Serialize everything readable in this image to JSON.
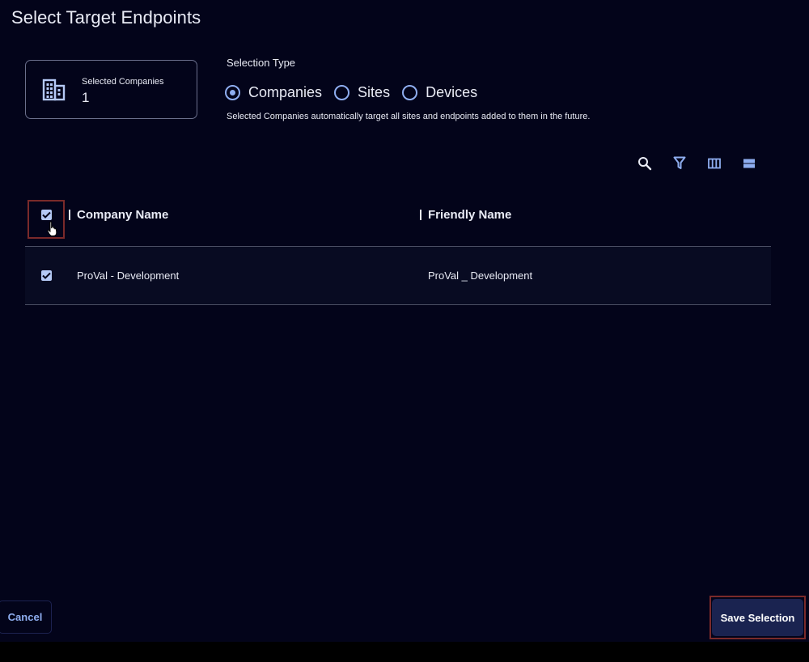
{
  "dialog": {
    "title": "Select Target Endpoints"
  },
  "summary": {
    "label": "Selected Companies",
    "count": "1",
    "icon": "building-icon"
  },
  "selection_type": {
    "label": "Selection Type",
    "options": [
      {
        "label": "Companies",
        "selected": true
      },
      {
        "label": "Sites",
        "selected": false
      },
      {
        "label": "Devices",
        "selected": false
      }
    ],
    "helper_text": "Selected Companies automatically target all sites and endpoints added to them in the future."
  },
  "toolbar": {
    "icons": [
      "search-icon",
      "filter-icon",
      "columns-icon",
      "density-icon"
    ]
  },
  "grid": {
    "columns": [
      "Company Name",
      "Friendly Name"
    ],
    "header_checked": true,
    "rows": [
      {
        "checked": true,
        "company_name": "ProVal - Development",
        "friendly_name": "ProVal _ Development"
      }
    ]
  },
  "actions": {
    "cancel_label": "Cancel",
    "save_label": "Save Selection"
  },
  "colors": {
    "background": "#03041a",
    "accent": "#8faef0",
    "text": "#e9ebf5",
    "row_background": "#080b22",
    "primary_button": "#1a2350"
  }
}
